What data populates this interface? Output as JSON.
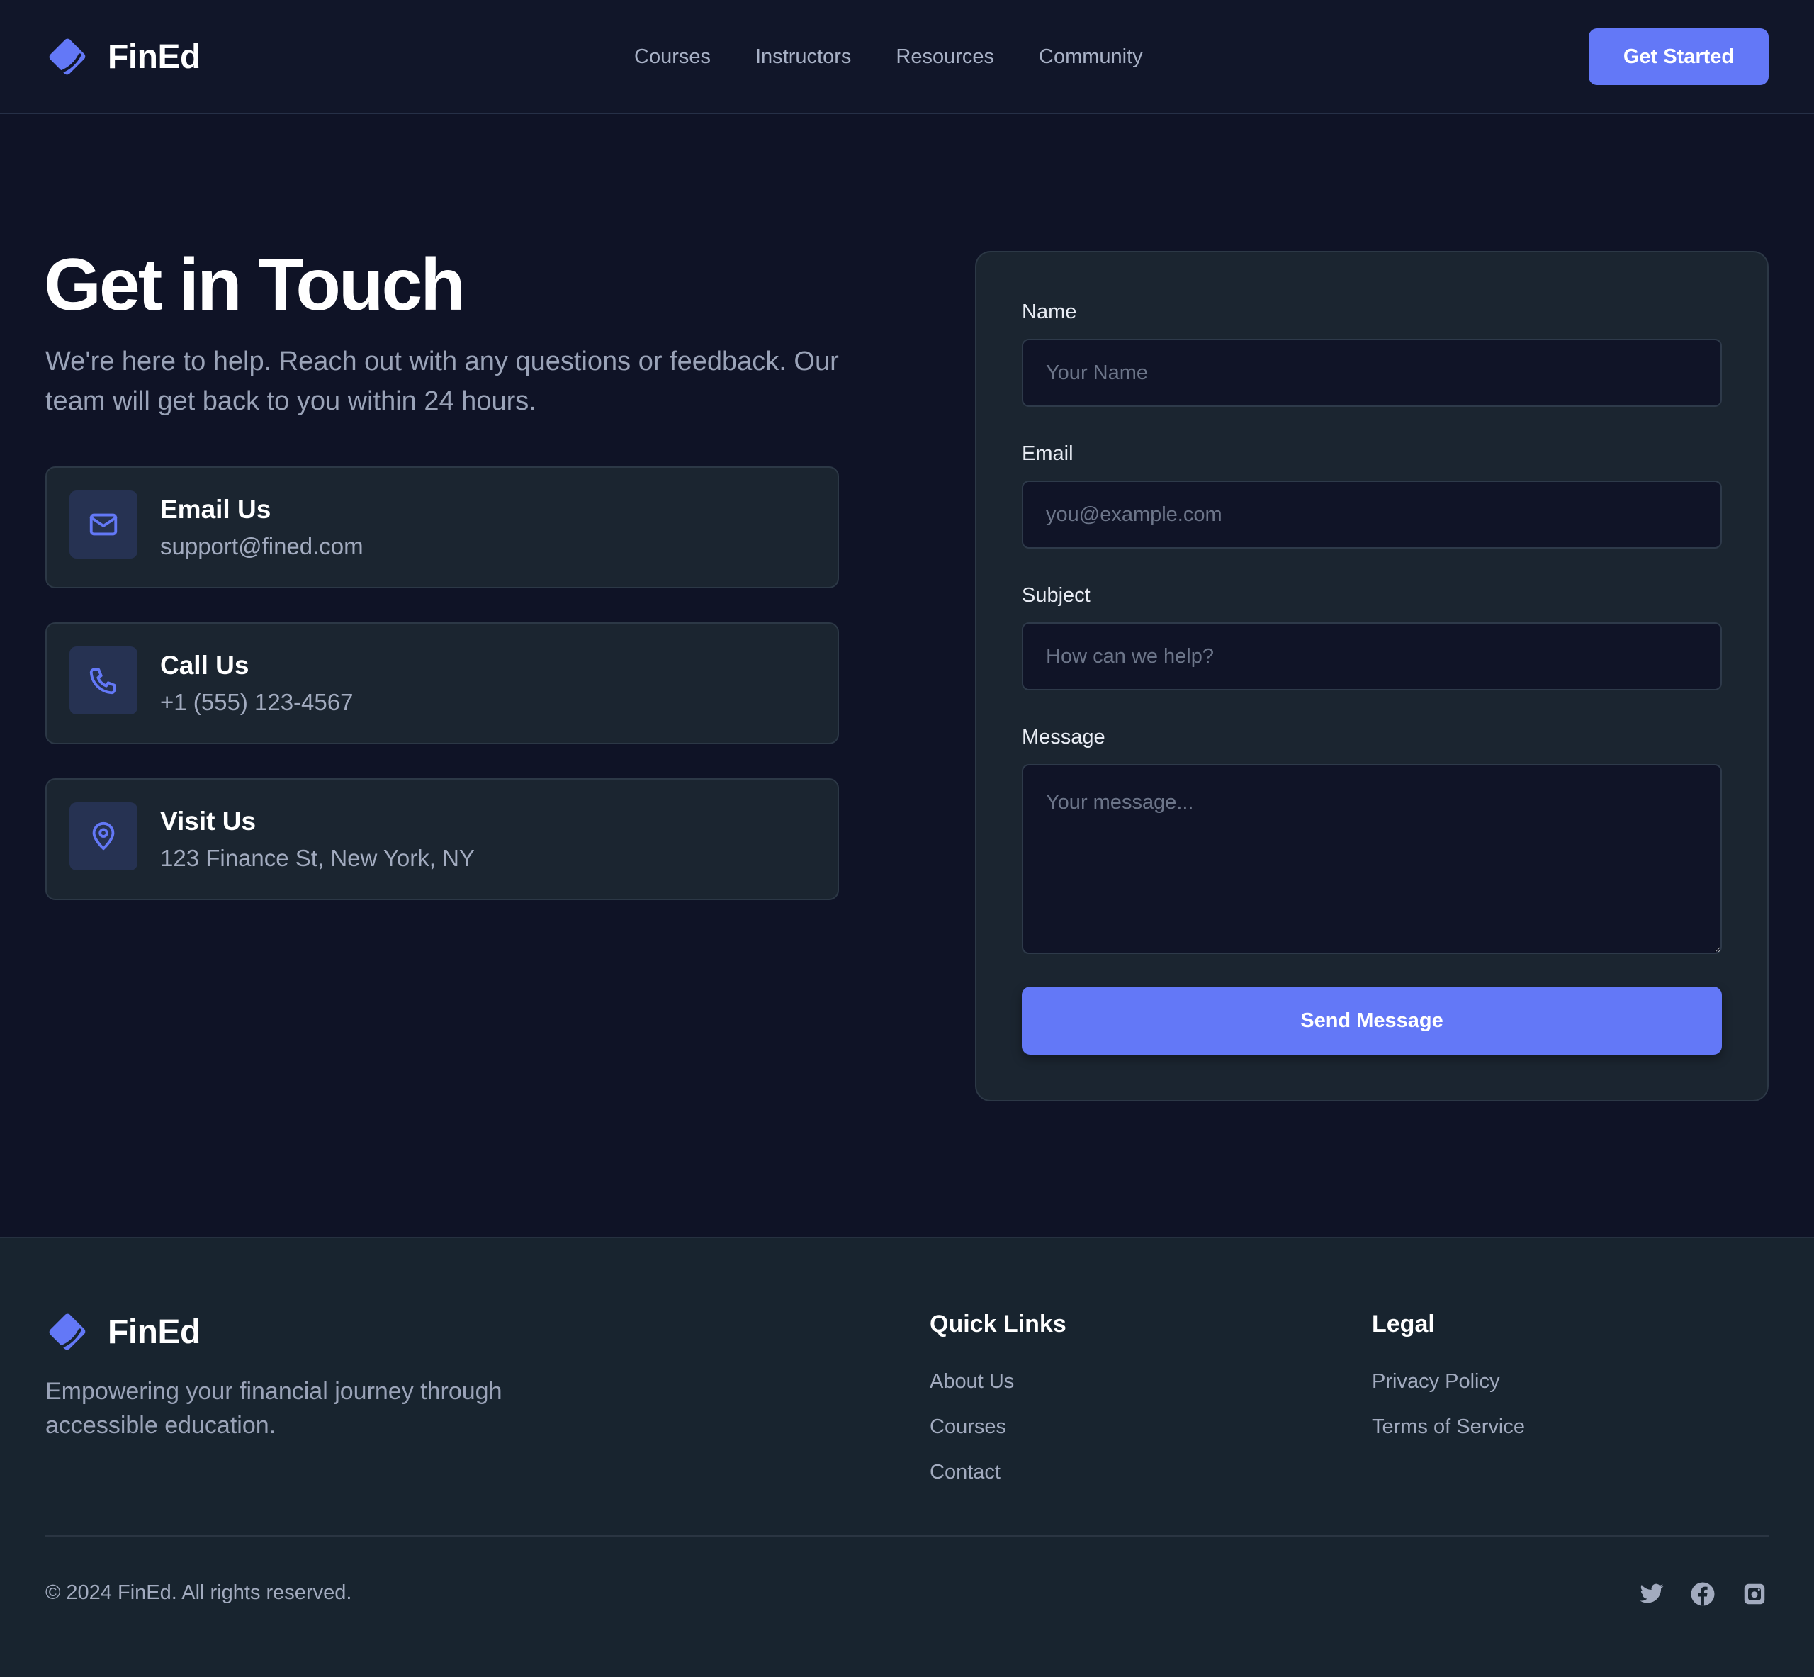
{
  "header": {
    "brand": "FinEd",
    "nav": [
      "Courses",
      "Instructors",
      "Resources",
      "Community"
    ],
    "cta": "Get Started"
  },
  "hero": {
    "title": "Get in Touch",
    "subtitle": "We're here to help. Reach out with any questions or feedback. Our team will get back to you within 24 hours."
  },
  "contact_cards": [
    {
      "icon": "mail-icon",
      "title": "Email Us",
      "value": "support@fined.com"
    },
    {
      "icon": "phone-icon",
      "title": "Call Us",
      "value": "+1 (555) 123-4567"
    },
    {
      "icon": "map-pin-icon",
      "title": "Visit Us",
      "value": "123 Finance St, New York, NY"
    }
  ],
  "form": {
    "name_label": "Name",
    "name_placeholder": "Your Name",
    "email_label": "Email",
    "email_placeholder": "you@example.com",
    "subject_label": "Subject",
    "subject_placeholder": "How can we help?",
    "message_label": "Message",
    "message_placeholder": "Your message...",
    "submit": "Send Message"
  },
  "footer": {
    "brand": "FinEd",
    "tagline": "Empowering your financial journey through accessible education.",
    "quick_links_title": "Quick Links",
    "quick_links": [
      "About Us",
      "Courses",
      "Contact"
    ],
    "legal_title": "Legal",
    "legal_links": [
      "Privacy Policy",
      "Terms of Service"
    ],
    "copyright": "© 2024 FinEd. All rights reserved.",
    "social": [
      "twitter-icon",
      "facebook-icon",
      "instagram-icon"
    ]
  },
  "colors": {
    "background": "#0f1326",
    "surface": "#1b2530",
    "accent": "#6378f7",
    "muted_text": "#9aa3b8"
  }
}
